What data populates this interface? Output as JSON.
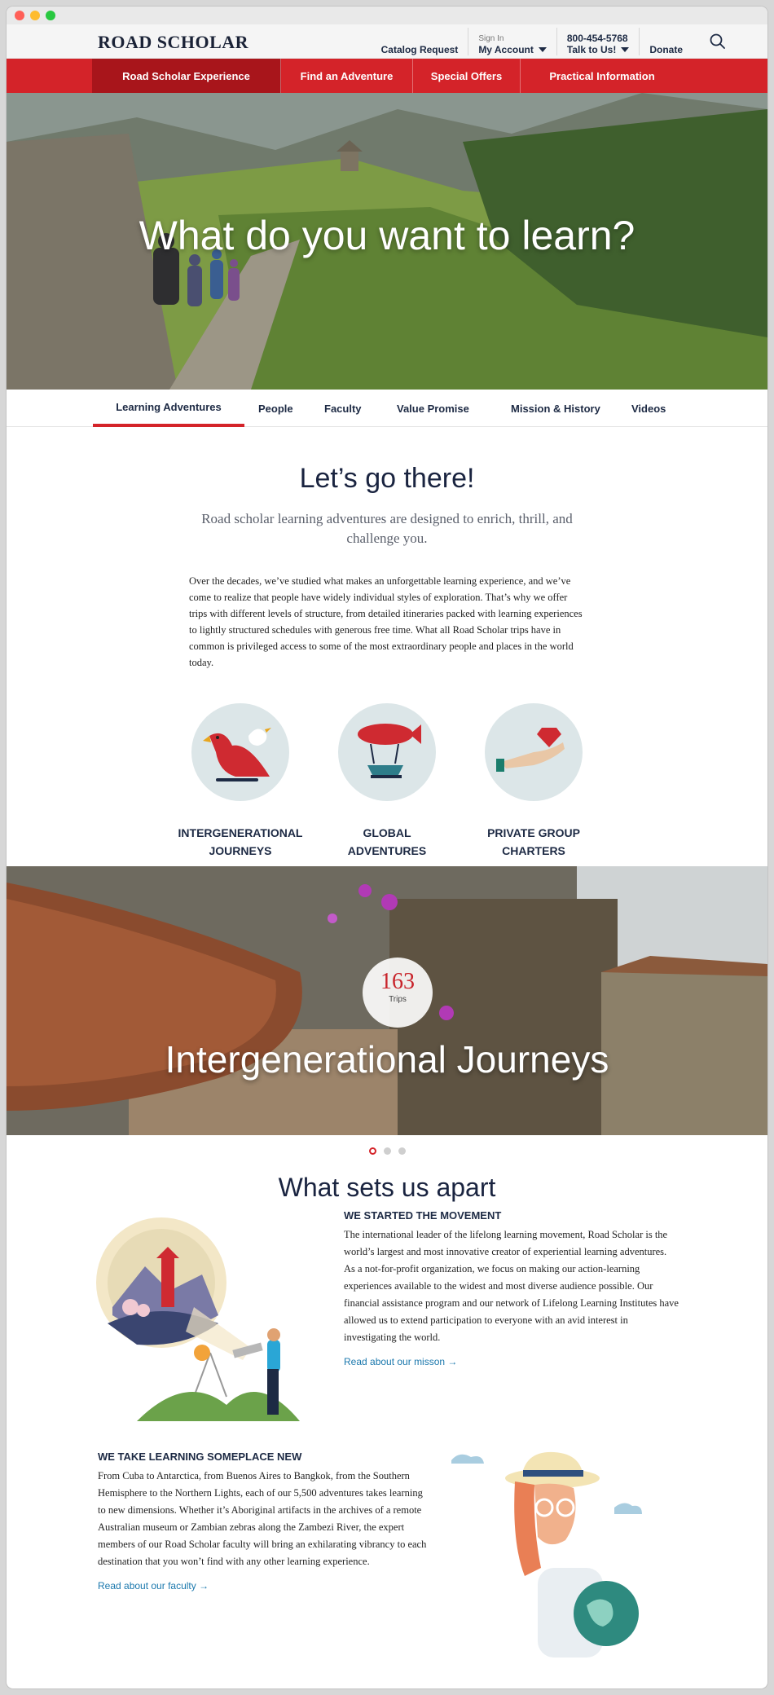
{
  "header": {
    "logo": "ROAD SCHOLAR",
    "catalog_request": "Catalog Request",
    "sign_in": "Sign In",
    "my_account": "My Account",
    "phone": "800-454-5768",
    "talk_to_us": "Talk to Us!",
    "donate": "Donate"
  },
  "mainnav": [
    "Road Scholar Experience",
    "Find an Adventure",
    "Special Offers",
    "Practical Information"
  ],
  "hero": {
    "title": "What do you want to learn?"
  },
  "subnav": [
    "Learning Adventures",
    "People",
    "Faculty",
    "Value Promise",
    "Mission & History",
    "Videos"
  ],
  "intro": {
    "title": "Let’s go there!",
    "lead": "Road scholar learning adventures are designed to enrich, thrill, and challenge you.",
    "body": "Over the decades, we’ve studied what makes an unforgettable learning experience, and we’ve come to realize that people have widely individual styles of exploration. That’s why we offer trips with different levels of structure, from detailed itineraries packed with learning experiences to lightly structured schedules with generous free time. What all Road Scholar trips have in common is privileged access to some of the most extraordinary people and places in the world today."
  },
  "features": [
    {
      "line1": "INTERGENERATIONAL",
      "line2": "JOURNEYS",
      "icon": "bird-icon"
    },
    {
      "line1": "GLOBAL",
      "line2": "ADVENTURES",
      "icon": "airship-icon"
    },
    {
      "line1": "PRIVATE GROUP",
      "line2": "CHARTERS",
      "icon": "gem-hand-icon"
    }
  ],
  "carousel": {
    "count": "163",
    "count_label": "Trips",
    "title": "Intergenerational Journeys",
    "active_slide": 1,
    "total_slides": 3
  },
  "apart": {
    "title": "What sets us apart",
    "movement": {
      "heading": "WE STARTED THE MOVEMENT",
      "text": "The international leader of the lifelong learning movement, Road Scholar is the world’s largest and most innovative creator of experiential learning adventures. As a not-for-profit organization, we focus on making our action-learning experiences available to the widest and most diverse audience possible. Our financial assistance program and our network of Lifelong Learning Institutes have allowed us to extend participation to everyone with an avid interest in investigating the world.",
      "link": "Read about our misson →"
    },
    "learning": {
      "heading": "WE TAKE LEARNING SOMEPLACE NEW",
      "text": "From Cuba to Antarctica, from Buenos Aires to Bangkok, from the Southern Hemisphere to the Northern Lights, each of our 5,500 adventures takes learning to new dimensions. Whether it’s Aboriginal artifacts in the archives of a remote Australian museum or Zambian zebras along the Zambezi River, the expert members of our Road Scholar faculty will bring an exhilarating vibrancy to each destination that you won’t find with any other learning experience.",
      "link": "Read about our faculty →"
    }
  },
  "colors": {
    "brand_red": "#d42329",
    "nav_active": "#a8151b",
    "link_blue": "#1b78ad",
    "navy": "#1d2a44"
  }
}
